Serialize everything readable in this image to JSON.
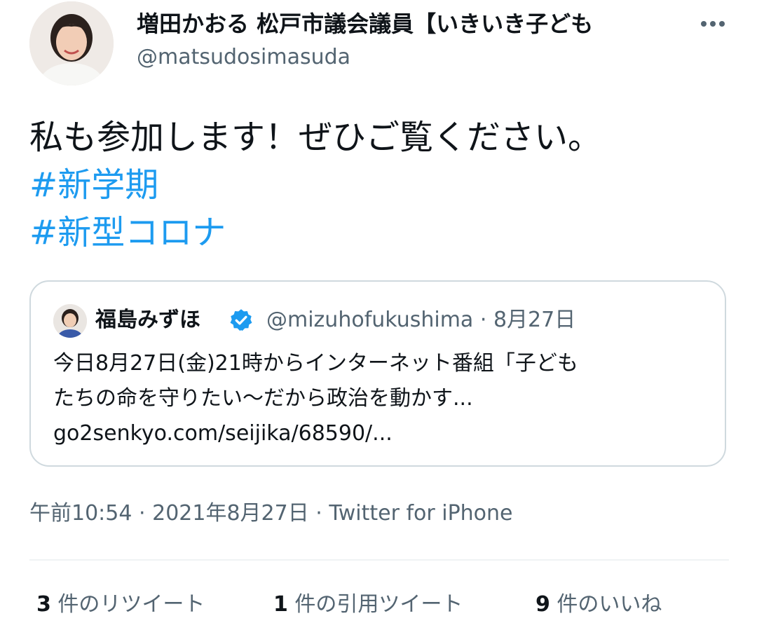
{
  "author": {
    "display_name": "増田かおる 松戸市議会議員【いきいき子ども",
    "handle": "@matsudosimasuda"
  },
  "tweet": {
    "text": "私も参加します！ぜひご覧ください。",
    "hashtags": [
      "#新学期",
      "#新型コロナ"
    ]
  },
  "quoted_tweet": {
    "display_name": "福島みずほ",
    "verified": true,
    "handle": "@mizuhofukushima",
    "separator": "·",
    "date": "8月27日",
    "text_lines": [
      "今日8月27日(金)21時からインターネット番組「子ども",
      "たちの命を守りたい〜だから政治を動かす...",
      "go2senkyo.com/seijika/68590/..."
    ]
  },
  "metadata": {
    "time": "午前10:54",
    "sep1": "·",
    "date": "2021年8月27日",
    "sep2": "·",
    "source": "Twitter for iPhone"
  },
  "stats": {
    "retweets": {
      "count": "3",
      "label": "件のリツイート"
    },
    "quotes": {
      "count": "1",
      "label": "件の引用ツイート"
    },
    "likes": {
      "count": "9",
      "label": "件のいいね"
    }
  },
  "colors": {
    "accent": "#1d9bf0",
    "text": "#0f1419",
    "secondary": "#536471",
    "border": "#cfd9de"
  },
  "icons": {
    "more": "more-dots-icon",
    "verified": "verified-badge-icon"
  }
}
